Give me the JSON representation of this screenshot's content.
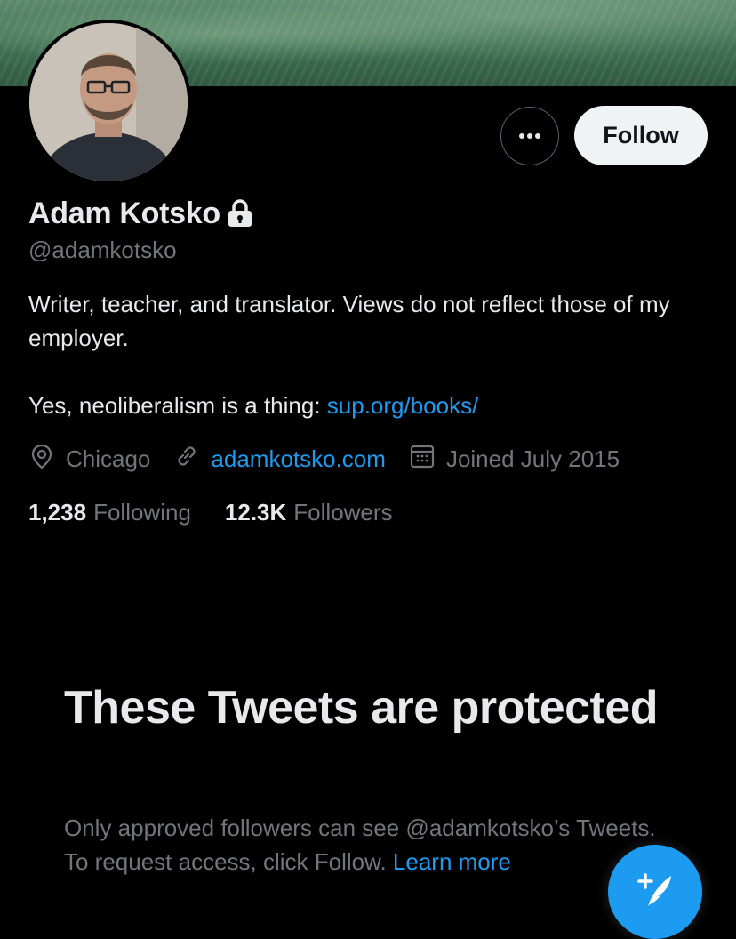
{
  "profile": {
    "display_name": "Adam Kotsko",
    "handle": "@adamkotsko",
    "bio_line1": "Writer, teacher, and translator. Views do not reflect those of my employer.",
    "bio_line2_text": "Yes, neoliberalism is a thing: ",
    "bio_line2_link": "sup.org/books/",
    "location": "Chicago",
    "website": "adamkotsko.com",
    "joined": "Joined July 2015"
  },
  "actions": {
    "follow_label": "Follow",
    "more_icon": "more-horizontal-icon"
  },
  "stats": {
    "following_count": "1,238",
    "following_label": "Following",
    "followers_count": "12.3K",
    "followers_label": "Followers"
  },
  "protected": {
    "title": "These Tweets are protected",
    "description": "Only approved followers can see @adamkotsko’s Tweets. To request access, click Follow. ",
    "learn_more": "Learn more"
  },
  "colors": {
    "background": "#000000",
    "primary_text": "#e7e9ea",
    "secondary_text": "#71767b",
    "link": "#1d9bf0",
    "follow_button_bg": "#eff3f4"
  }
}
